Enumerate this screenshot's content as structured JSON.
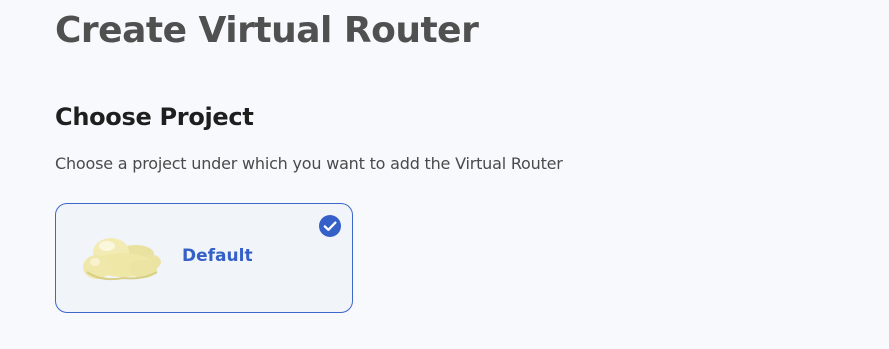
{
  "page": {
    "title": "Create Virtual Router"
  },
  "section": {
    "title": "Choose Project",
    "description": "Choose a project under which you want to add the Virtual Router"
  },
  "projects": [
    {
      "name": "Default",
      "icon": "cloud-icon",
      "selected": true
    }
  ],
  "colors": {
    "accent": "#3560c8",
    "card_border": "#3d68c9",
    "card_bg": "#f1f4f9",
    "page_bg": "#f8f9fc",
    "cloud": "#efe7a6"
  }
}
